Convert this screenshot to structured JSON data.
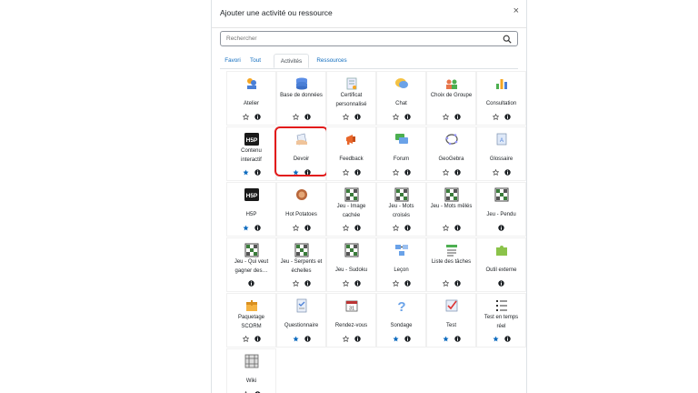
{
  "dialog": {
    "title": "Ajouter une activité ou ressource",
    "close_label": "×",
    "search_placeholder": "Rechercher",
    "tabs": [
      {
        "label": "Favori",
        "active": false
      },
      {
        "label": "Tout",
        "active": false
      },
      {
        "label": "Activités",
        "active": true
      },
      {
        "label": "Ressources",
        "active": false
      }
    ]
  },
  "colors": {
    "accent": "#0f6cbf",
    "starred": "#0f6cbf",
    "highlight": "#e21b1b"
  },
  "items": [
    {
      "label": "Atelier",
      "icon": "workshop-icon",
      "starred": false,
      "star": true
    },
    {
      "label": "Base de données",
      "icon": "database-icon",
      "starred": false,
      "star": true
    },
    {
      "label": "Certificat personnalisé",
      "icon": "certificate-icon",
      "starred": false,
      "star": true
    },
    {
      "label": "Chat",
      "icon": "chat-icon",
      "starred": false,
      "star": true
    },
    {
      "label": "Choix de Groupe",
      "icon": "group-choice-icon",
      "starred": false,
      "star": true
    },
    {
      "label": "Consultation",
      "icon": "poll-icon",
      "starred": false,
      "star": true
    },
    {
      "label": "Contenu interactif",
      "icon": "h5p-icon",
      "starred": true,
      "star": true
    },
    {
      "label": "Devoir",
      "icon": "assignment-icon",
      "starred": true,
      "star": true,
      "highlighted": true
    },
    {
      "label": "Feedback",
      "icon": "megaphone-icon",
      "starred": false,
      "star": true
    },
    {
      "label": "Forum",
      "icon": "forum-icon",
      "starred": false,
      "star": true
    },
    {
      "label": "GeoGebra",
      "icon": "geogebra-icon",
      "starred": false,
      "star": true
    },
    {
      "label": "Glossaire",
      "icon": "glossary-icon",
      "starred": false,
      "star": true
    },
    {
      "label": "H5P",
      "icon": "h5p-icon",
      "starred": true,
      "star": true
    },
    {
      "label": "Hot Potatoes",
      "icon": "hotpot-icon",
      "starred": false,
      "star": true
    },
    {
      "label": "Jeu - Image cachée",
      "icon": "game-grid-icon",
      "starred": false,
      "star": true
    },
    {
      "label": "Jeu - Mots croisés",
      "icon": "game-grid-icon",
      "starred": false,
      "star": true
    },
    {
      "label": "Jeu - Mots mêlés",
      "icon": "game-grid-icon",
      "starred": false,
      "star": true
    },
    {
      "label": "Jeu - Pendu",
      "icon": "game-grid-icon",
      "starred": false,
      "star": false
    },
    {
      "label": "Jeu - Qui veut gagner des…",
      "icon": "game-grid-icon",
      "starred": false,
      "star": false
    },
    {
      "label": "Jeu - Serpents et échelles",
      "icon": "game-grid-icon",
      "starred": false,
      "star": true
    },
    {
      "label": "Jeu - Sudoku",
      "icon": "game-grid-icon",
      "starred": false,
      "star": true
    },
    {
      "label": "Leçon",
      "icon": "lesson-icon",
      "starred": false,
      "star": true
    },
    {
      "label": "Liste des tâches",
      "icon": "checklist-icon",
      "starred": false,
      "star": true
    },
    {
      "label": "Outil externe",
      "icon": "puzzle-icon",
      "starred": false,
      "star": false
    },
    {
      "label": "Paquetage SCORM",
      "icon": "scorm-package-icon",
      "starred": false,
      "star": true
    },
    {
      "label": "Questionnaire",
      "icon": "questionnaire-icon",
      "starred": true,
      "star": true
    },
    {
      "label": "Rendez-vous",
      "icon": "calendar-icon",
      "starred": false,
      "star": true
    },
    {
      "label": "Sondage",
      "icon": "question-mark-icon",
      "starred": true,
      "star": true
    },
    {
      "label": "Test",
      "icon": "quiz-icon",
      "starred": true,
      "star": true
    },
    {
      "label": "Test en temps réel",
      "icon": "list-icon",
      "starred": true,
      "star": true
    },
    {
      "label": "Wiki",
      "icon": "wiki-icon",
      "starred": false,
      "star": true
    }
  ]
}
